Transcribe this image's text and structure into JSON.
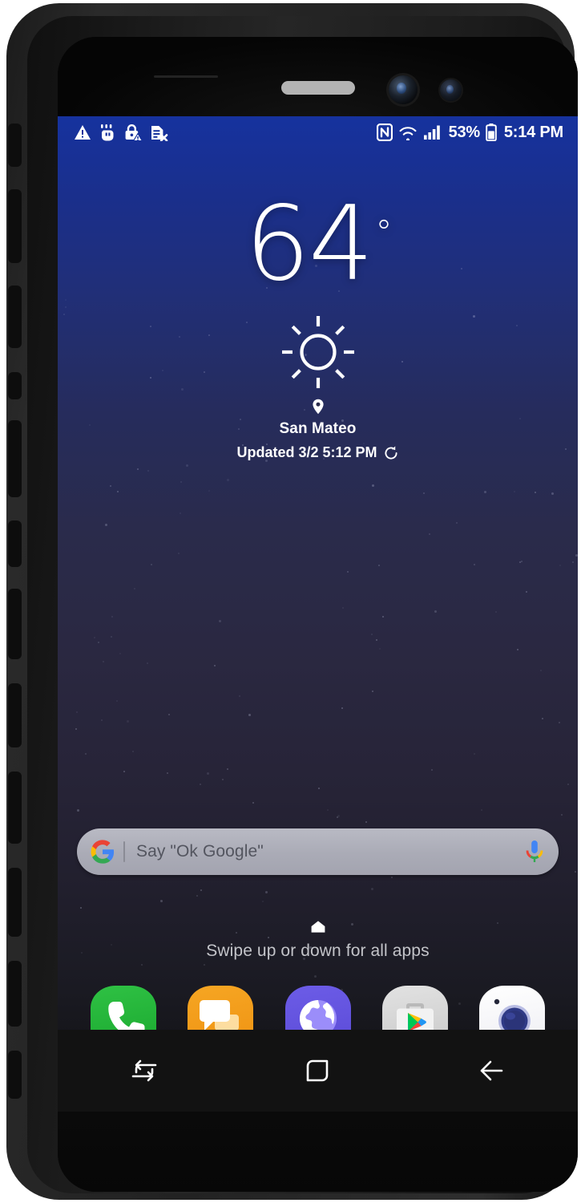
{
  "device": {
    "type": "smartphone-in-rugged-case",
    "screen_state": "home-screen"
  },
  "status_bar": {
    "left_icons": [
      {
        "name": "warning-triangle-icon",
        "label": "Warning"
      },
      {
        "name": "touch-hand-icon",
        "label": "Touch assistance"
      },
      {
        "name": "lock-warning-icon",
        "label": "Lock warning"
      },
      {
        "name": "sim-card-error-icon",
        "label": "No SIM card"
      }
    ],
    "right_icons": [
      {
        "name": "nfc-icon",
        "label": "NFC"
      },
      {
        "name": "wifi-icon",
        "label": "Wi-Fi"
      },
      {
        "name": "signal-bars-icon",
        "label": "Cellular signal"
      }
    ],
    "battery_percent": "53%",
    "battery_icon": "battery-icon",
    "clock": "5:14 PM"
  },
  "weather_widget": {
    "temperature": "64",
    "degree_symbol": "°",
    "condition_icon": "sun-icon",
    "condition": "Clear",
    "location_icon": "location-pin-icon",
    "city": "San Mateo",
    "updated_text": "Updated 3/2 5:12 PM",
    "refresh_icon": "refresh-icon"
  },
  "search_bar": {
    "google_logo_icon": "google-g-icon",
    "placeholder": "Say \"Ok Google\"",
    "mic_icon": "google-mic-icon"
  },
  "swipe_hint": {
    "page_indicator_icon": "home-page-indicator-icon",
    "text": "Swipe up or down for all apps"
  },
  "dock": {
    "apps": [
      {
        "label": "Phone",
        "icon": "phone-handset-icon",
        "color": "#2fc144"
      },
      {
        "label": "Messages",
        "icon": "speech-bubbles-icon",
        "color": "#f6a623"
      },
      {
        "label": "Internet",
        "icon": "globe-icon",
        "color": "#6c5ce7"
      },
      {
        "label": "Play Store",
        "icon": "play-store-bag-icon",
        "color": "#d8d8d8"
      },
      {
        "label": "Camera",
        "icon": "camera-lens-icon",
        "color": "#ffffff"
      }
    ]
  },
  "nav_bar": {
    "buttons": [
      {
        "name": "recents-button",
        "icon": "recents-icon",
        "label": "Recents"
      },
      {
        "name": "home-button",
        "icon": "home-square-icon",
        "label": "Home"
      },
      {
        "name": "back-button",
        "icon": "back-arrow-icon",
        "label": "Back"
      }
    ]
  },
  "colors": {
    "wallpaper_top": "#16329e",
    "wallpaper_bottom": "#0e0e10",
    "status_bar_text": "#ffffff",
    "search_bar_bg": "#b0b1bc",
    "case_body": "#222222"
  }
}
